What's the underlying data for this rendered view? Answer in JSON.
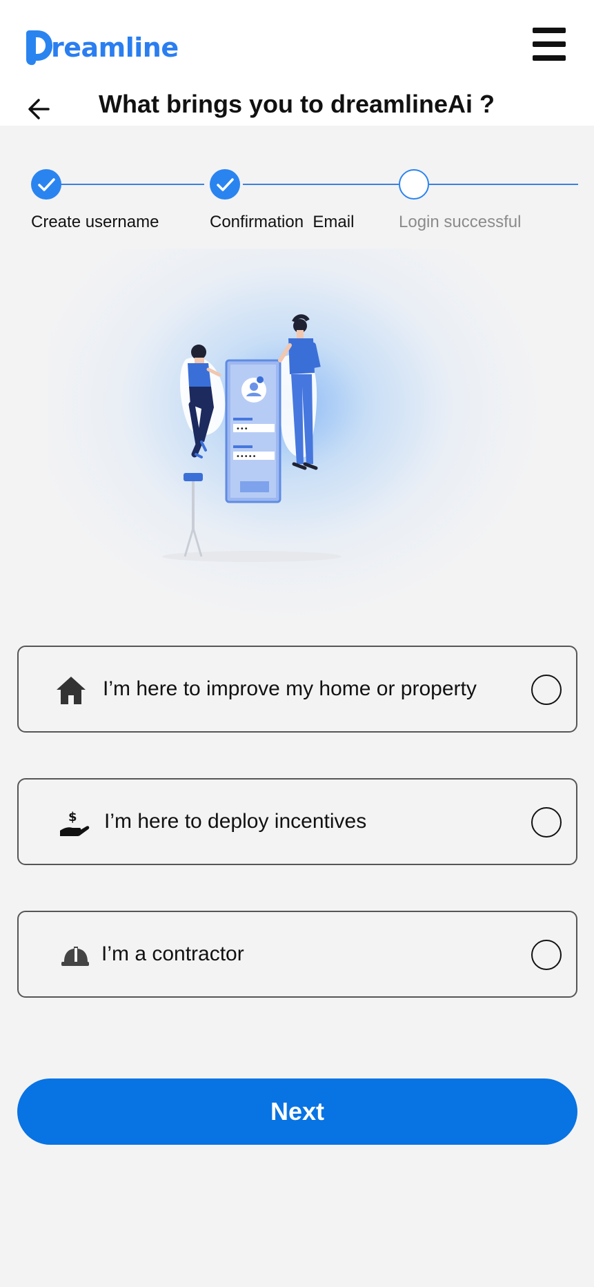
{
  "brand": {
    "logo_text": "reamline",
    "accent_color": "#2a84f0",
    "button_color": "#0873e3"
  },
  "header": {
    "title": "What brings you to dreamlineAi ?",
    "menu_icon": "hamburger-menu-icon",
    "back_icon": "arrow-left-icon"
  },
  "stepper": {
    "steps": [
      {
        "label": "Create username",
        "state": "done"
      },
      {
        "label": "Confirmation  Email",
        "state": "done"
      },
      {
        "label": "Login successful",
        "state": "pending"
      }
    ]
  },
  "options": [
    {
      "label": "I’m here to improve my home or property",
      "icon": "house-icon",
      "selected": false
    },
    {
      "label": "I’m here to deploy incentives",
      "icon": "hand-dollar-icon",
      "selected": false
    },
    {
      "label": "I’m a contractor",
      "icon": "hard-hat-icon",
      "selected": false
    }
  ],
  "next_button": {
    "label": "Next"
  }
}
